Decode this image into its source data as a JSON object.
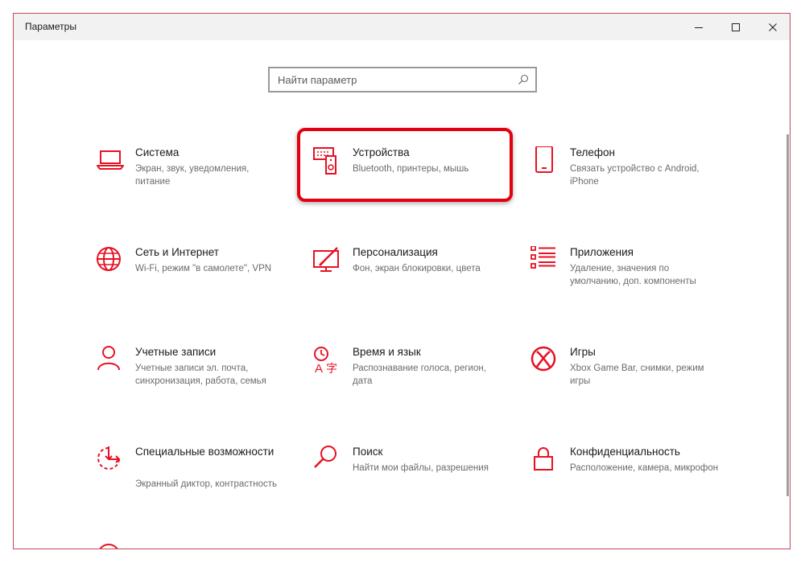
{
  "window": {
    "title": "Параметры",
    "controls": [
      "minimize",
      "maximize",
      "close"
    ]
  },
  "search": {
    "placeholder": "Найти параметр",
    "icon": "search-icon"
  },
  "accent_color": "#e81123",
  "highlight_color": "#e3000f",
  "tiles": [
    {
      "title": "Система",
      "desc": "Экран, звук, уведомления, питание",
      "icon": "laptop-icon"
    },
    {
      "title": "Устройства",
      "desc": "Bluetooth, принтеры, мышь",
      "icon": "devices-icon"
    },
    {
      "title": "Телефон",
      "desc": "Связать устройство с Android, iPhone",
      "icon": "phone-icon"
    },
    {
      "title": "Сеть и Интернет",
      "desc": "Wi-Fi, режим \"в самолете\", VPN",
      "icon": "globe-icon"
    },
    {
      "title": "Персонализация",
      "desc": "Фон, экран блокировки, цвета",
      "icon": "personalization-icon"
    },
    {
      "title": "Приложения",
      "desc": "Удаление, значения по умолчанию, доп. компоненты",
      "icon": "apps-list-icon"
    },
    {
      "title": "Учетные записи",
      "desc": "Учетные записи эл. почта, синхронизация, работа, семья",
      "icon": "person-icon"
    },
    {
      "title": "Время и язык",
      "desc": "Распознавание голоса, регион, дата",
      "icon": "time-language-icon"
    },
    {
      "title": "Игры",
      "desc": "Xbox Game Bar, снимки, режим игры",
      "icon": "xbox-icon"
    },
    {
      "title": "Специальные возможности",
      "desc": "Экранный диктор, контрастность",
      "icon": "accessibility-icon"
    },
    {
      "title": "Поиск",
      "desc": "Найти мои файлы, разрешения",
      "icon": "search-icon"
    },
    {
      "title": "Конфиденциальность",
      "desc": "Расположение, камера, микрофон",
      "icon": "lock-icon"
    }
  ]
}
